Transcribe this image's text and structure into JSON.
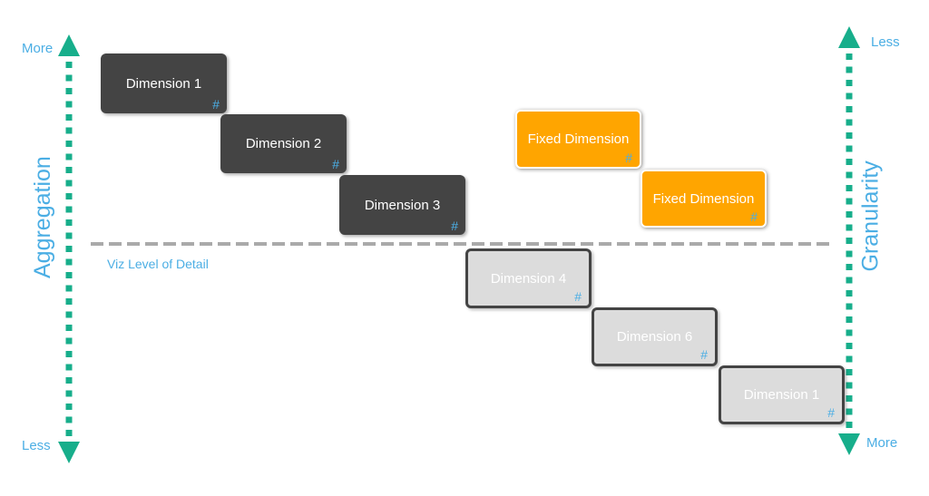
{
  "colors": {
    "arrow": "#17AE8B",
    "text": "#4BAEE4",
    "dark_box": "#444444",
    "fixed_box": "#FFA500",
    "light_box": "#DCDCDC",
    "lod_line": "#AAAAAA"
  },
  "left_axis": {
    "title": "Aggregation",
    "top": "More",
    "bottom": "Less"
  },
  "right_axis": {
    "title": "Granularity",
    "top": "Less",
    "bottom": "More"
  },
  "lod_label": "Viz Level of Detail",
  "marker": "#",
  "boxes": {
    "d1": "Dimension 1",
    "d2": "Dimension 2",
    "d3": "Dimension 3",
    "f1": "Fixed Dimension",
    "f2": "Fixed Dimension",
    "d4": "Dimension 4",
    "d6": "Dimension 6",
    "d1b": "Dimension 1"
  }
}
